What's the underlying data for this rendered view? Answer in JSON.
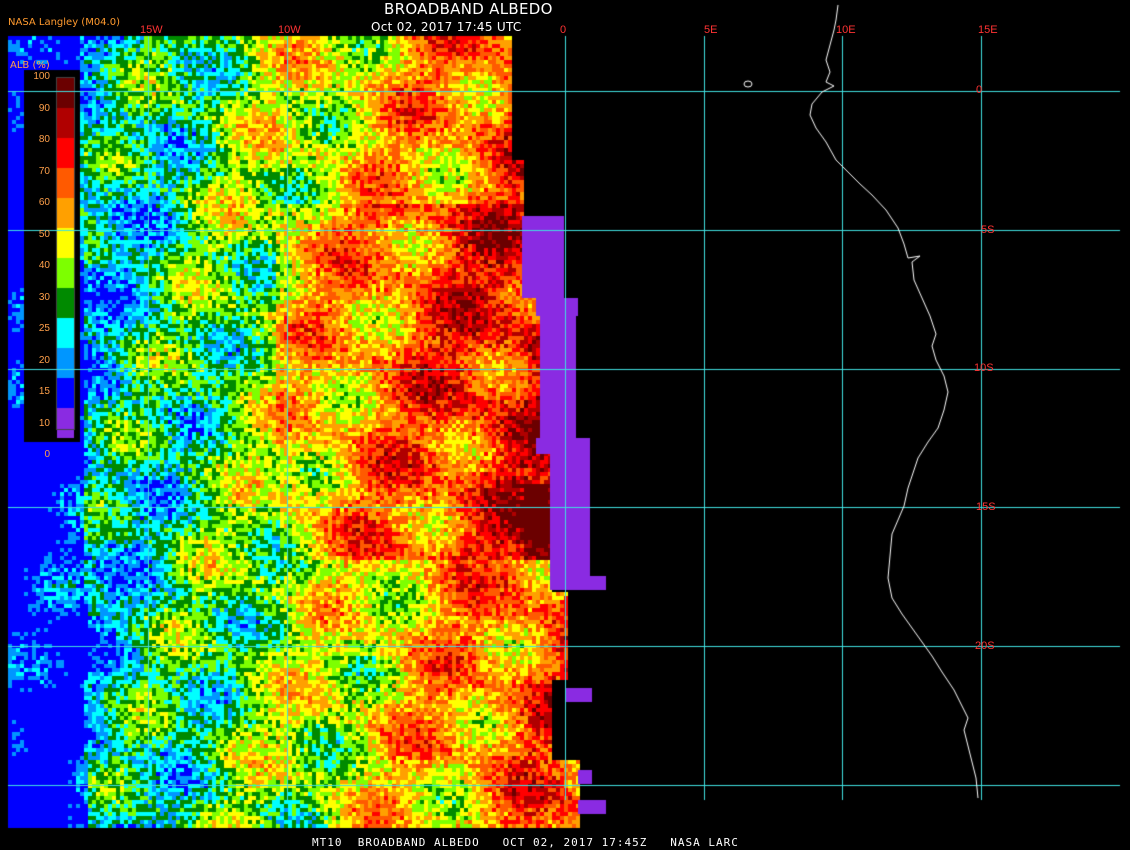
{
  "header": {
    "title": "BROADBAND ALBEDO",
    "datetime": "Oct 02, 2017 17:45 UTC",
    "credit": "NASA Langley (M04.0)"
  },
  "footer": {
    "text": "MT10  BROADBAND ALBEDO   OCT 02, 2017 17:45Z   NASA LARC"
  },
  "legend": {
    "title": "ALB (%)",
    "items": [
      {
        "label": "100",
        "color": "#6b0000"
      },
      {
        "label": "90",
        "color": "#b00000"
      },
      {
        "label": "80",
        "color": "#ff0000"
      },
      {
        "label": "70",
        "color": "#ff5a00"
      },
      {
        "label": "60",
        "color": "#ffa000"
      },
      {
        "label": "50",
        "color": "#ffff00"
      },
      {
        "label": "40",
        "color": "#7dff00"
      },
      {
        "label": "30",
        "color": "#008a00"
      },
      {
        "label": "25",
        "color": "#00ffff"
      },
      {
        "label": "20",
        "color": "#0096ff"
      },
      {
        "label": "15",
        "color": "#0000ff"
      },
      {
        "label": "10",
        "color": "#8a2be2"
      },
      {
        "label": "0",
        "color": ""
      }
    ]
  },
  "axes": {
    "longitude_labels": [
      "15W",
      "10W",
      "0",
      "5E",
      "10E",
      "15E"
    ],
    "latitude_labels": [
      "0",
      "5S",
      "10S",
      "15S",
      "20S"
    ]
  },
  "colors": {
    "grid": "#40e0e0",
    "label": "#ff3333",
    "coastline": "#ffffff",
    "legend_text": "#ffa04a",
    "no_data": "#8a2be2"
  }
}
